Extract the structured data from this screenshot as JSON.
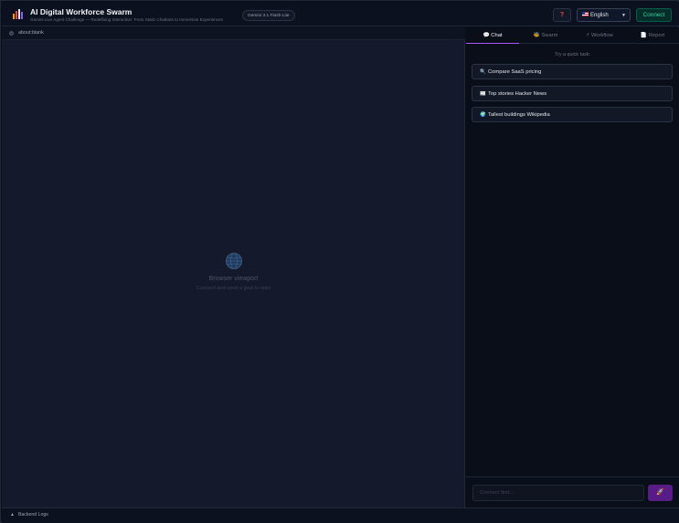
{
  "header": {
    "title": "AI Digital Workforce Swarm",
    "subtitle": "Gemini Live Agent Challenge — Redefining Interaction: From Static Chatbots to Immersive Experiences",
    "model_badge": "Gemini 3.1 Flash-Lite",
    "help_label": "?",
    "language": "English",
    "connect_label": "Connect"
  },
  "browser": {
    "url": "about:blank",
    "empty_title": "Browser viewport",
    "empty_subtitle": "Connect and send a goal to start"
  },
  "tabs": [
    {
      "icon": "💬",
      "label": "Chat"
    },
    {
      "icon": "🐝",
      "label": "Swarm"
    },
    {
      "icon": "⚡",
      "label": "Workflow"
    },
    {
      "icon": "📄",
      "label": "Report"
    }
  ],
  "quick": {
    "title": "Try a quick task:",
    "items": [
      {
        "icon": "🔍",
        "label": "Compare SaaS pricing"
      },
      {
        "icon": "📰",
        "label": "Top stories Hacker News"
      },
      {
        "icon": "🌍",
        "label": "Tallest buildings Wikipedia"
      }
    ]
  },
  "compose": {
    "placeholder": "Connect first...",
    "send_icon": "rocket-icon"
  },
  "footer": {
    "logs_label": "Backend Logs"
  },
  "colors": {
    "accent": "#a855f7",
    "connect": "#34d399",
    "background": "#0b0f1a"
  }
}
